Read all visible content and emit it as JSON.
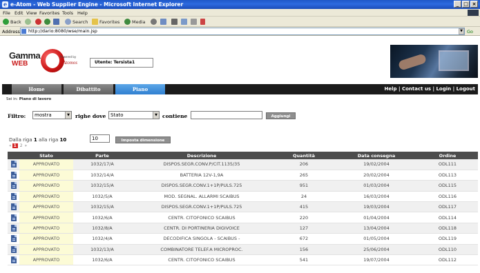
{
  "window": {
    "title": "e-Atom - Web Supplier Engine - Microsoft Internet Explorer",
    "buttons": [
      "_",
      "□",
      "×"
    ]
  },
  "menu": [
    "File",
    "Edit",
    "View",
    "Favorites",
    "Tools",
    "Help"
  ],
  "toolbar": {
    "back": "Back",
    "search": "Search",
    "favorites": "Favorites",
    "media": "Media"
  },
  "address": {
    "label": "Address",
    "url": "http://dario:8080/wse/main.jsp",
    "go": "Go"
  },
  "logo": {
    "gamma": "Gamma",
    "web": "WEB",
    "powered": "Powered by",
    "atomos": "Atomos"
  },
  "user": "Utente: Tersista1",
  "tabs": [
    {
      "label": "Home",
      "active": false
    },
    {
      "label": "Dibattito",
      "active": false
    },
    {
      "label": "Piano",
      "active": true
    }
  ],
  "toplinks": "Help | Contact us | Login | Logout",
  "breadcrumb": {
    "prefix": "Sei in:",
    "page": "Piano di lavoro"
  },
  "filter": {
    "label": "Filtro:",
    "mode": "mostra",
    "rows_label": "righe dove",
    "field": "Stato",
    "contains_label": "contiene",
    "value": "",
    "add_button": "Aggiungi"
  },
  "range": {
    "from_label": "Dalla riga",
    "from": "1",
    "to_label": "alla riga",
    "to": "10",
    "size": "10",
    "set_button": "Imposta dimensione"
  },
  "pager": {
    "prev": "«",
    "current": "1",
    "next_page": "2",
    "next": "»"
  },
  "table": {
    "headers": [
      "",
      "Stato",
      "Parte",
      "Descrizione",
      "Quantità",
      "Data consegna",
      "Ordine"
    ],
    "rows": [
      [
        "APPROVATO",
        "1032/17/A",
        "DISPOS.SEGR.CONV.P/CIT.1135/35",
        "206",
        "19/02/2004",
        "ODL111"
      ],
      [
        "APPROVATO",
        "1032/14/A",
        "BATTERIA 12V-1,9A",
        "265",
        "20/02/2004",
        "ODL113"
      ],
      [
        "APPROVATO",
        "1032/15/A",
        "DISPOS.SEGR.CONV.1+1P/PULS.725",
        "951",
        "01/03/2004",
        "ODL115"
      ],
      [
        "APPROVATO",
        "1032/5/A",
        "MOD. SEGNAL. ALLARMI SCAIBUS",
        "24",
        "16/03/2004",
        "ODL116"
      ],
      [
        "APPROVATO",
        "1032/15/A",
        "DISPOS.SEGR.CONV.1+1P/PULS.725",
        "415",
        "19/03/2004",
        "ODL117"
      ],
      [
        "APPROVATO",
        "1032/6/A",
        "CENTR. CITOFONICO SCAIBUS",
        "220",
        "01/04/2004",
        "ODL114"
      ],
      [
        "APPROVATO",
        "1032/8/A",
        "CENTR. DI PORTINERIA DIGIVOICE",
        "127",
        "13/04/2004",
        "ODL118"
      ],
      [
        "APPROVATO",
        "1032/4/A",
        "DECODIFICA SINGOLA - SCAIBUS -",
        "672",
        "01/05/2004",
        "ODL119"
      ],
      [
        "APPROVATO",
        "1032/13/A",
        "COMBINATORE TELEF.A MICROPROC.",
        "156",
        "25/06/2004",
        "ODL110"
      ],
      [
        "APPROVATO",
        "1032/6/A",
        "CENTR. CITOFONICO SCAIBUS",
        "541",
        "19/07/2004",
        "ODL112"
      ]
    ]
  }
}
